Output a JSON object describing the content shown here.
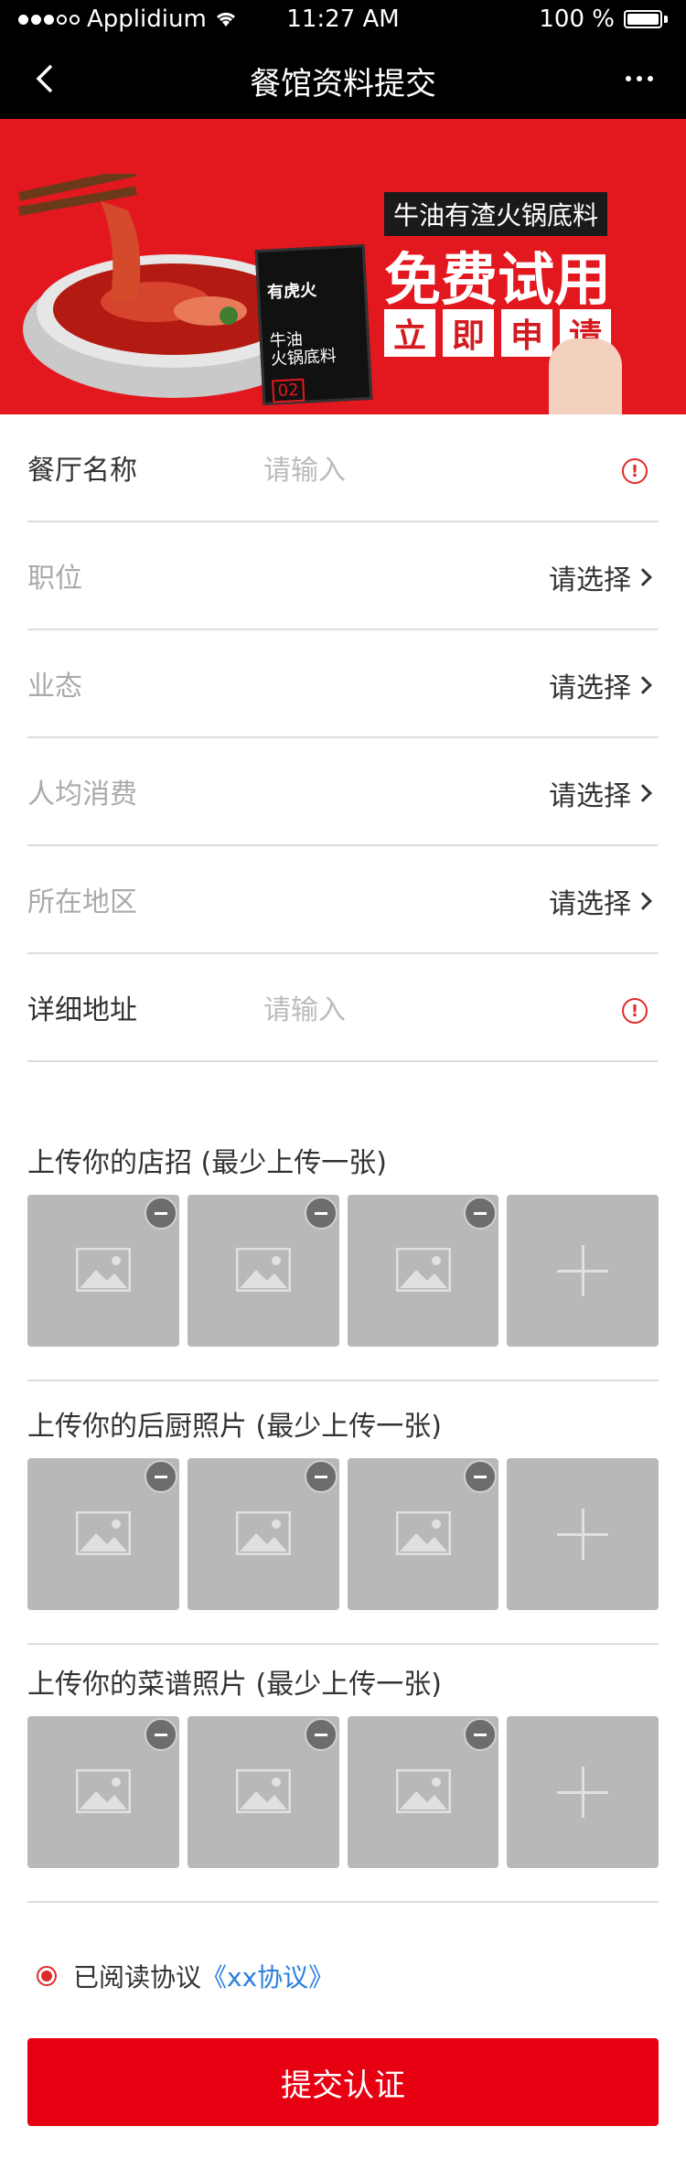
{
  "status_bar": {
    "carrier": "Applidium",
    "time": "11:27 AM",
    "battery": "100 %"
  },
  "nav": {
    "title": "餐馆资料提交"
  },
  "banner": {
    "subtitle": "牛油有渣火锅底料",
    "headline": "免费试用",
    "cta_chars": [
      "立",
      "即",
      "申",
      "请"
    ],
    "pack_brand": "有虎火",
    "pack_name_line1": "牛油",
    "pack_name_line2": "火锅底料",
    "pack_number": "02"
  },
  "form": {
    "restaurant_name": {
      "label": "餐厅名称",
      "placeholder": "请输入"
    },
    "position": {
      "label": "职位",
      "value": "请选择"
    },
    "business_type": {
      "label": "业态",
      "value": "请选择"
    },
    "avg_spend": {
      "label": "人均消费",
      "value": "请选择"
    },
    "region": {
      "label": "所在地区",
      "value": "请选择"
    },
    "address": {
      "label": "详细地址",
      "placeholder": "请输入"
    }
  },
  "uploads": {
    "sign": {
      "title": "上传你的店招 (最少上传一张)"
    },
    "kitchen": {
      "title": "上传你的后厨照片 (最少上传一张)"
    },
    "menu": {
      "title": "上传你的菜谱照片 (最少上传一张)"
    }
  },
  "agreement": {
    "text": "已阅读协议",
    "link": "《xx协议》"
  },
  "submit": {
    "label": "提交认证"
  },
  "colors": {
    "primary": "#e60012",
    "link": "#2a7fde",
    "warning": "#e12b2b"
  }
}
